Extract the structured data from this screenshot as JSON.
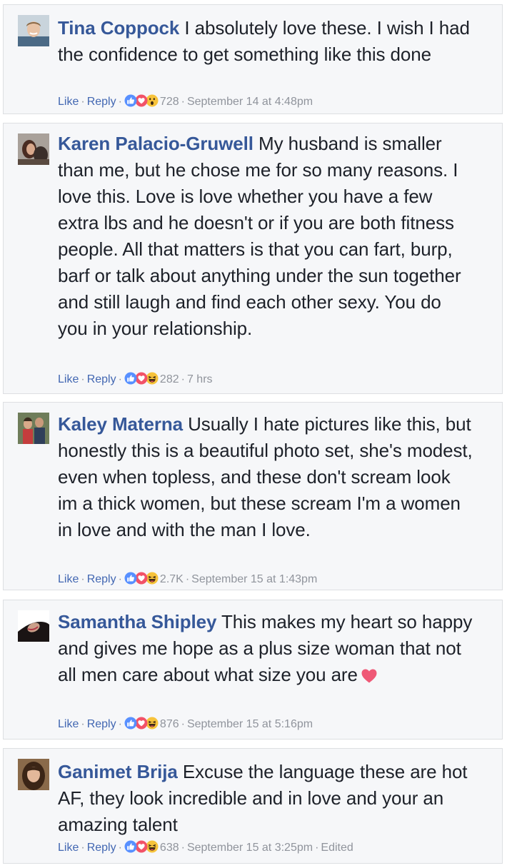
{
  "actions": {
    "like": "Like",
    "reply": "Reply",
    "separator": "·"
  },
  "comments": [
    {
      "author": "Tina Coppock",
      "text": "I absolutely love these. I wish I had the confidence to get something like this done",
      "reaction_count": "728",
      "timestamp": "September 14 at 4:48pm",
      "reactions": [
        "like-icon",
        "love-icon",
        "wow-icon"
      ]
    },
    {
      "author": "Karen Palacio-Gruwell",
      "text": "My husband is smaller than me, but he chose me for so many reasons. I love this. Love is love whether you have a few extra lbs and he doesn't or if you are both fitness people. All that matters is that you can fart, burp, barf or talk about anything under the sun together and still laugh and find each other sexy. You do you in your relationship.",
      "reaction_count": "282",
      "timestamp": "7 hrs",
      "reactions": [
        "like-icon",
        "love-icon",
        "haha-icon"
      ]
    },
    {
      "author": "Kaley Materna",
      "text": "Usually I hate pictures like this, but honestly this is a beautiful photo set, she's modest, even when topless, and these don't scream look im a thick women, but these scream I'm a women in love and with the man I love.",
      "reaction_count": "2.7K",
      "timestamp": "September 15 at 1:43pm",
      "reactions": [
        "like-icon",
        "love-icon",
        "haha-icon"
      ]
    },
    {
      "author": "Samantha Shipley",
      "text": "This makes my heart so happy and gives me hope as a plus size woman that not all men care about what size you are",
      "reaction_count": "876",
      "timestamp": "September 15 at 5:16pm",
      "reactions": [
        "like-icon",
        "love-icon",
        "haha-icon"
      ],
      "trailing_icon": "heart-emoji-icon"
    },
    {
      "author": "Ganimet Brija",
      "text": "Excuse the language these are hot AF, they look incredible and in love and your an amazing talent",
      "reaction_count": "638",
      "timestamp": "September 15 at 3:25pm",
      "edited_label": "Edited",
      "reactions": [
        "like-icon",
        "love-icon",
        "haha-icon"
      ]
    }
  ]
}
